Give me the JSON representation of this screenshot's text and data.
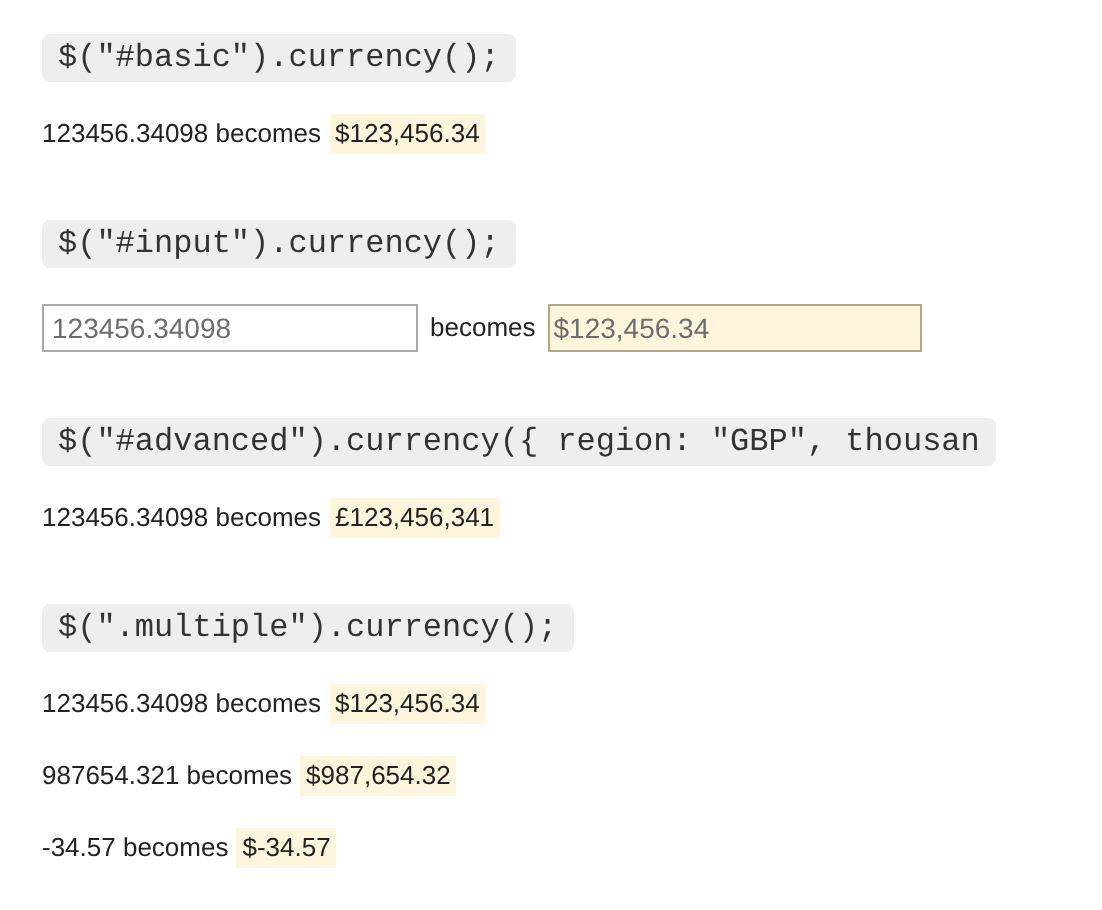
{
  "sections": [
    {
      "code": "$(\"#basic\").currency();",
      "rows": [
        {
          "kind": "text",
          "input": "123456.34098",
          "word": "becomes",
          "output": "$123,456.34"
        }
      ]
    },
    {
      "code": "$(\"#input\").currency();",
      "rows": [
        {
          "kind": "field",
          "input": "123456.34098",
          "word": "becomes",
          "output": "$123,456.34"
        }
      ]
    },
    {
      "code": "$(\"#advanced\").currency({ region: \"GBP\", thousan",
      "rows": [
        {
          "kind": "text",
          "input": "123456.34098",
          "word": "becomes",
          "output": "£123,456,341"
        }
      ]
    },
    {
      "code": "$(\".multiple\").currency();",
      "rows": [
        {
          "kind": "text",
          "input": "123456.34098",
          "word": "becomes",
          "output": "$123,456.34"
        },
        {
          "kind": "text",
          "input": "987654.321",
          "word": "becomes",
          "output": "$987,654.32"
        },
        {
          "kind": "text",
          "input": "-34.57",
          "word": "becomes",
          "output": "$-34.57"
        }
      ]
    }
  ]
}
